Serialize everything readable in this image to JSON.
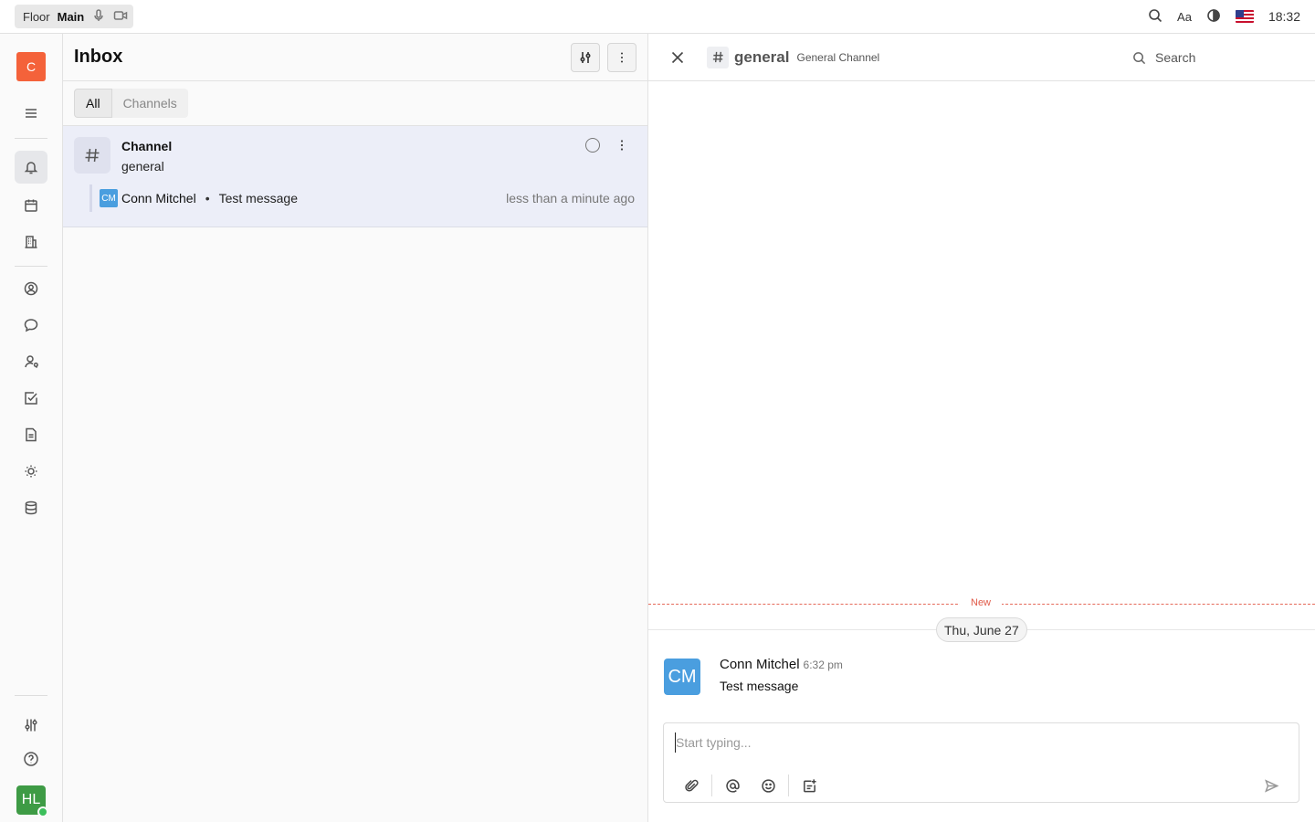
{
  "topbar": {
    "workspace_label": "Floor",
    "room_label": "Main",
    "language_label": "Aa",
    "clock": "18:32",
    "icons": [
      "microphone-icon",
      "video-camera-icon",
      "search-icon",
      "contrast-icon",
      "us-flag-icon"
    ]
  },
  "leftnav": {
    "workspace_initial": "C",
    "user_initials": "HL",
    "colors": {
      "workspace": "#f4623a",
      "user": "#3e9b45",
      "online": "#3cbf5b"
    },
    "items": [
      "menu-icon",
      "bell-icon",
      "calendar-icon",
      "office-icon",
      "contacts-icon",
      "chat-icon",
      "recruit-icon",
      "tasks-icon",
      "documents-icon",
      "sun-icon",
      "database-icon",
      "settings-sliders-icon",
      "help-icon"
    ]
  },
  "inbox": {
    "title": "Inbox",
    "tabs": [
      {
        "label": "All",
        "active": true
      },
      {
        "label": "Channels",
        "active": false
      }
    ],
    "items": [
      {
        "type_label": "Channel",
        "name": "general",
        "message": {
          "initials": "CM",
          "author": "Conn Mitchel",
          "separator": "•",
          "text": "Test message",
          "time": "less than a minute ago"
        }
      }
    ]
  },
  "channel": {
    "name": "general",
    "description": "General Channel",
    "search_label": "Search",
    "new_label": "New",
    "date_label": "Thu, June 27",
    "messages": [
      {
        "initials": "CM",
        "author": "Conn Mitchel",
        "time": "6:32 pm",
        "text": "Test message"
      }
    ],
    "composer": {
      "placeholder": "Start typing...",
      "value": ""
    },
    "accent_colors": {
      "new_divider": "#e56a5a",
      "avatar": "#4a9edf"
    }
  }
}
